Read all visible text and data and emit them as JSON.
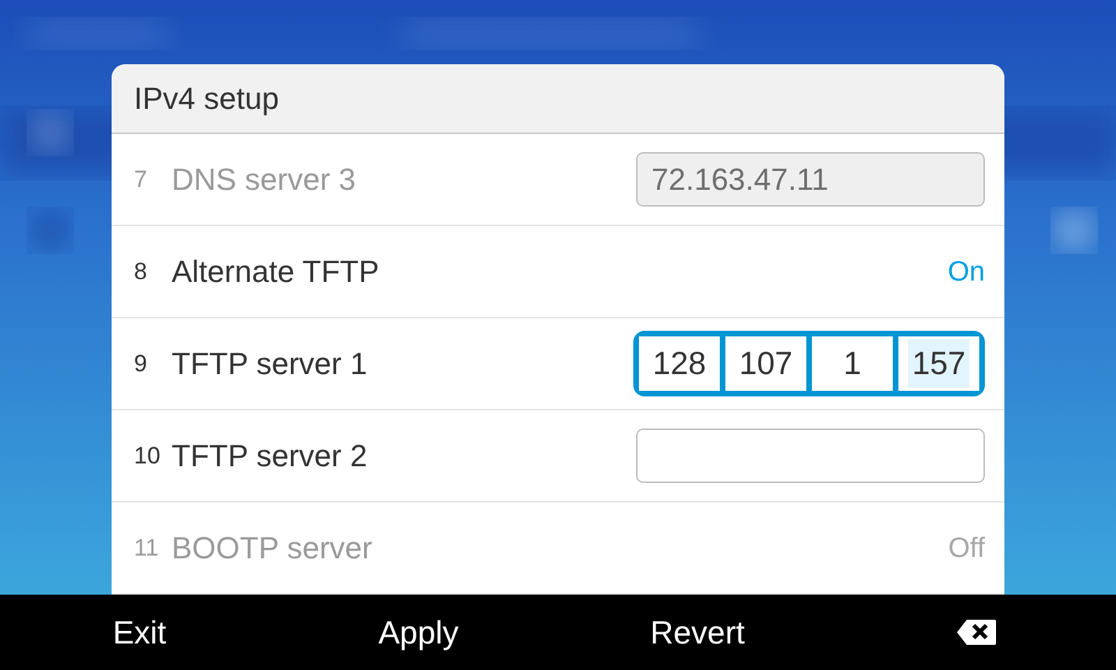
{
  "dialog": {
    "title": "IPv4 setup",
    "rows": [
      {
        "index": "7",
        "label": "DNS server 3",
        "kind": "field",
        "disabled": true,
        "value": "72.163.47.11"
      },
      {
        "index": "8",
        "label": "Alternate TFTP",
        "kind": "toggle",
        "disabled": false,
        "value": "On"
      },
      {
        "index": "9",
        "label": "TFTP server 1",
        "kind": "ip",
        "disabled": false,
        "octets": [
          {
            "value": "128",
            "selected": false
          },
          {
            "value": "107",
            "selected": false
          },
          {
            "value": "1",
            "selected": false
          },
          {
            "value": "157",
            "selected": true
          }
        ]
      },
      {
        "index": "10",
        "label": "TFTP server 2",
        "kind": "field",
        "disabled": false
      },
      {
        "index": "11",
        "label": "BOOTP server",
        "kind": "toggle",
        "disabled": true,
        "value": "Off"
      }
    ]
  },
  "softkeys": [
    "Exit",
    "Apply",
    "Revert"
  ]
}
